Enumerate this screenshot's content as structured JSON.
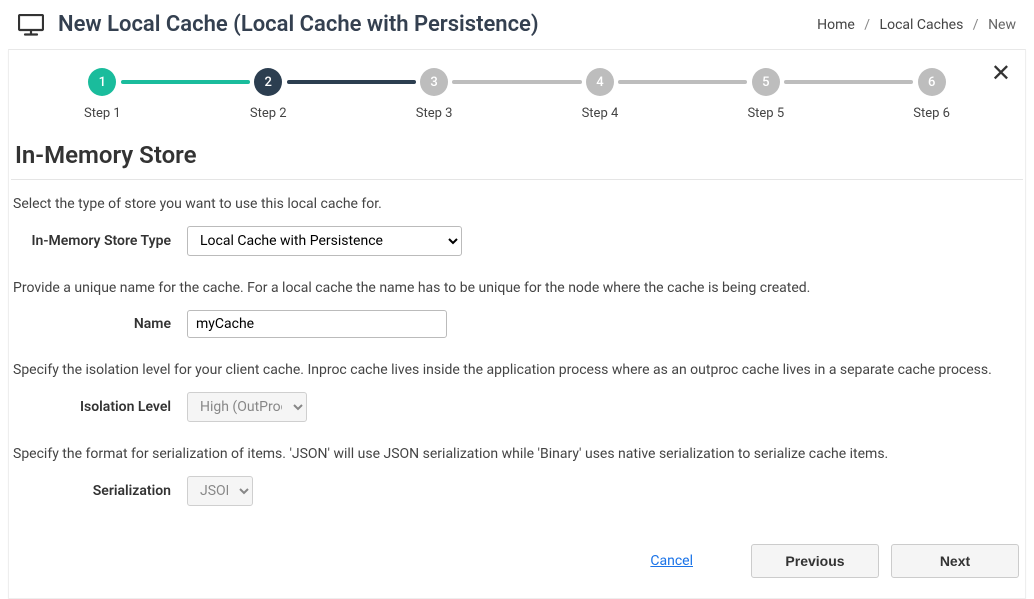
{
  "header": {
    "title": "New Local Cache (Local Cache with Persistence)"
  },
  "breadcrumb": {
    "home": "Home",
    "localCaches": "Local Caches",
    "current": "New"
  },
  "stepper": {
    "steps": [
      {
        "num": "1",
        "label": "Step 1"
      },
      {
        "num": "2",
        "label": "Step 2"
      },
      {
        "num": "3",
        "label": "Step 3"
      },
      {
        "num": "4",
        "label": "Step 4"
      },
      {
        "num": "5",
        "label": "Step 5"
      },
      {
        "num": "6",
        "label": "Step 6"
      }
    ]
  },
  "section": {
    "title": "In-Memory Store"
  },
  "form": {
    "storeHelp": "Select the type of store you want to use this local cache for.",
    "storeTypeLabel": "In-Memory Store Type",
    "storeTypeValue": "Local Cache with Persistence",
    "nameHelp": "Provide a unique name for the cache. For a local cache the name has to be unique for the node where the cache is being created.",
    "nameLabel": "Name",
    "nameValue": "myCache",
    "isolationHelp": "Specify the isolation level for your client cache. Inproc cache lives inside the application process where as an outproc cache lives in a separate cache process.",
    "isolationLabel": "Isolation Level",
    "isolationValue": "High (OutProc)",
    "serialHelp": "Specify the format for serialization of items. 'JSON' will use JSON serialization while 'Binary' uses native serialization to serialize cache items.",
    "serialLabel": "Serialization",
    "serialValue": "JSON"
  },
  "footer": {
    "cancel": "Cancel",
    "previous": "Previous",
    "next": "Next"
  }
}
